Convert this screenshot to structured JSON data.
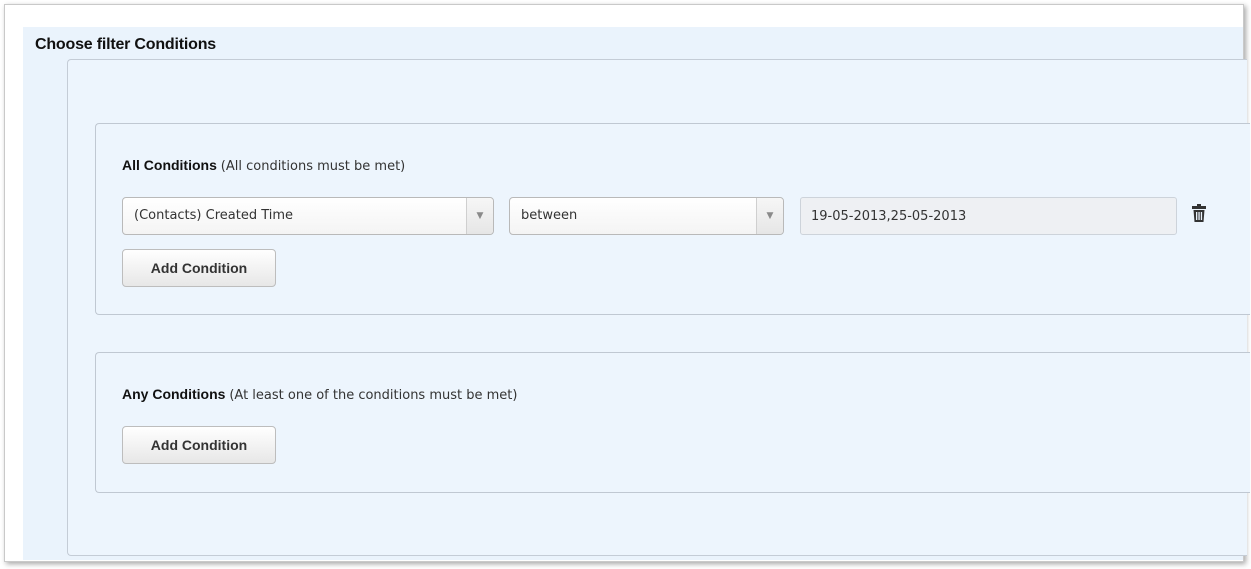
{
  "panel": {
    "title": "Choose filter Conditions"
  },
  "all_group": {
    "label": "All Conditions",
    "hint": "(All conditions must be met)",
    "condition": {
      "field": "(Contacts) Created Time",
      "operator": "between",
      "value": "19-05-2013,25-05-2013"
    },
    "add_label": "Add Condition"
  },
  "any_group": {
    "label": "Any Conditions",
    "hint": "(At least one of the conditions must be met)",
    "add_label": "Add Condition"
  },
  "icons": {
    "select_arrow": "chevron-down-icon",
    "delete": "trash-icon"
  }
}
